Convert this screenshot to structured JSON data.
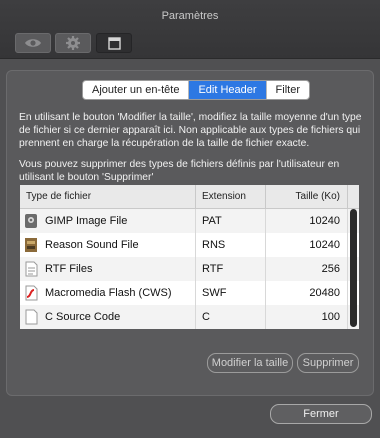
{
  "window": {
    "title": "Paramètres"
  },
  "toolbar": {
    "items": [
      {
        "icon": "eye-icon"
      },
      {
        "icon": "gear-icon"
      },
      {
        "icon": "window-icon"
      }
    ]
  },
  "tabs": [
    {
      "label": "Ajouter un en-tête",
      "selected": false
    },
    {
      "label": "Edit Header",
      "selected": true
    },
    {
      "label": "Filter",
      "selected": false
    }
  ],
  "description": {
    "p1": "En utilisant le bouton 'Modifier la taille', modifiez la taille moyenne d'un type de fichier si ce dernier apparaît ici. Non applicable aux types de fichiers qui prennent en charge la récupération de la taille de fichier exacte.",
    "p2": "Vous pouvez supprimer des types de fichiers définis par l'utilisateur en utilisant le bouton 'Supprimer'"
  },
  "table": {
    "headers": {
      "type": "Type de fichier",
      "ext": "Extension",
      "size": "Taille (Ko)"
    },
    "rows": [
      {
        "icon": "gimp-file-icon",
        "type": "GIMP Image File",
        "ext": "PAT",
        "size": "10240"
      },
      {
        "icon": "reason-file-icon",
        "type": "Reason Sound File",
        "ext": "RNS",
        "size": "10240"
      },
      {
        "icon": "rtf-file-icon",
        "type": "RTF Files",
        "ext": "RTF",
        "size": "256"
      },
      {
        "icon": "flash-file-icon",
        "type": "Macromedia Flash (CWS)",
        "ext": "SWF",
        "size": "20480"
      },
      {
        "icon": "c-source-file-icon",
        "type": "C Source Code",
        "ext": "C",
        "size": "100"
      }
    ]
  },
  "buttons": {
    "modify": "Modifier la taille",
    "delete": "Supprimer",
    "close": "Fermer"
  },
  "colors": {
    "accent": "#2d78e3",
    "window_bg": "#505052"
  }
}
